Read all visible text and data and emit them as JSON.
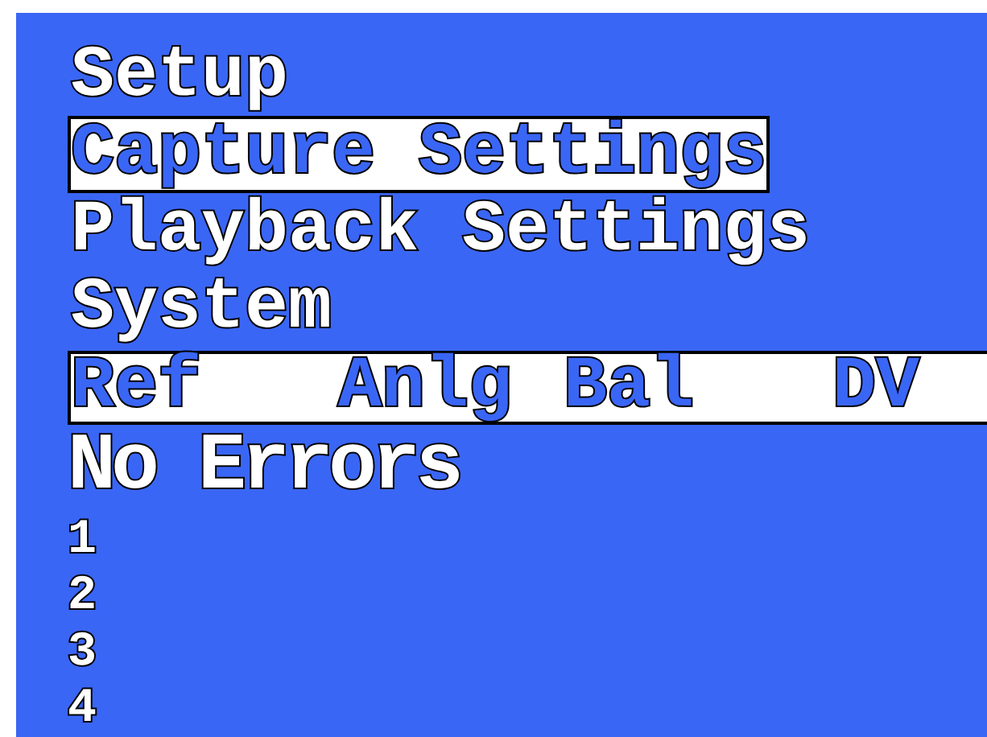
{
  "menu": [
    {
      "label": "Setup",
      "selected": false
    },
    {
      "label": "Capture Settings",
      "selected": true
    },
    {
      "label": "Playback Settings",
      "selected": false
    },
    {
      "label": "System",
      "selected": false
    }
  ],
  "status_bar": {
    "items": [
      "Ref",
      "Anlg",
      "Bal",
      "DV"
    ]
  },
  "message": "No Errors",
  "channels": [
    "1",
    "2",
    "3",
    "4"
  ]
}
